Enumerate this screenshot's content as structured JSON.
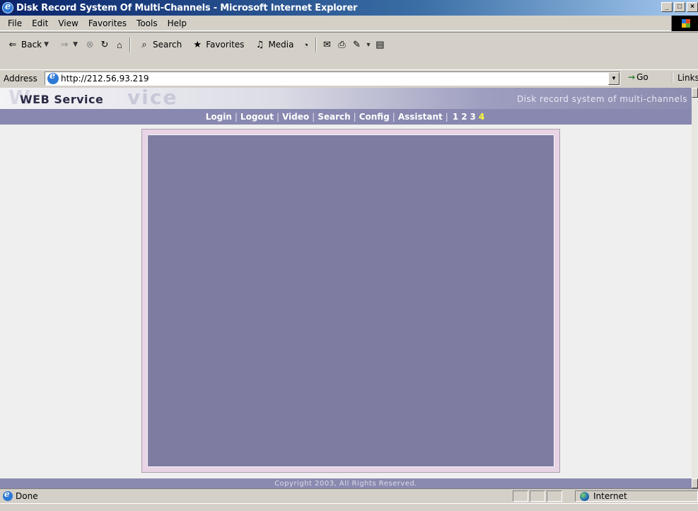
{
  "window": {
    "title": "Disk Record System Of Multi-Channels - Microsoft Internet Explorer",
    "controls": [
      "_",
      "□",
      "×"
    ]
  },
  "menu": [
    "File",
    "Edit",
    "View",
    "Favorites",
    "Tools",
    "Help"
  ],
  "toolbar": {
    "back": "Back",
    "search": "Search",
    "favorites": "Favorites",
    "media": "Media"
  },
  "address": {
    "label": "Address",
    "url": "http://212.56.93.219",
    "go": "Go",
    "links": "Links"
  },
  "page": {
    "brand": "WEB Service",
    "tagline": "Disk record system of multi-channels",
    "nav": {
      "login": "Login",
      "logout": "Logout",
      "video": "Video",
      "search": "Search",
      "config": "Config",
      "assistant": "Assistant",
      "pages": [
        "1",
        "2",
        "3",
        "4"
      ],
      "current_page": "4"
    },
    "copyright": "Copyright 2003,  All Rights Reserved."
  },
  "status": {
    "text": "Done",
    "zone": "Internet"
  },
  "colors": {
    "video_panel": "#7e7ca0",
    "nav_strip": "#8888b0",
    "current_page": "#ffff33"
  }
}
